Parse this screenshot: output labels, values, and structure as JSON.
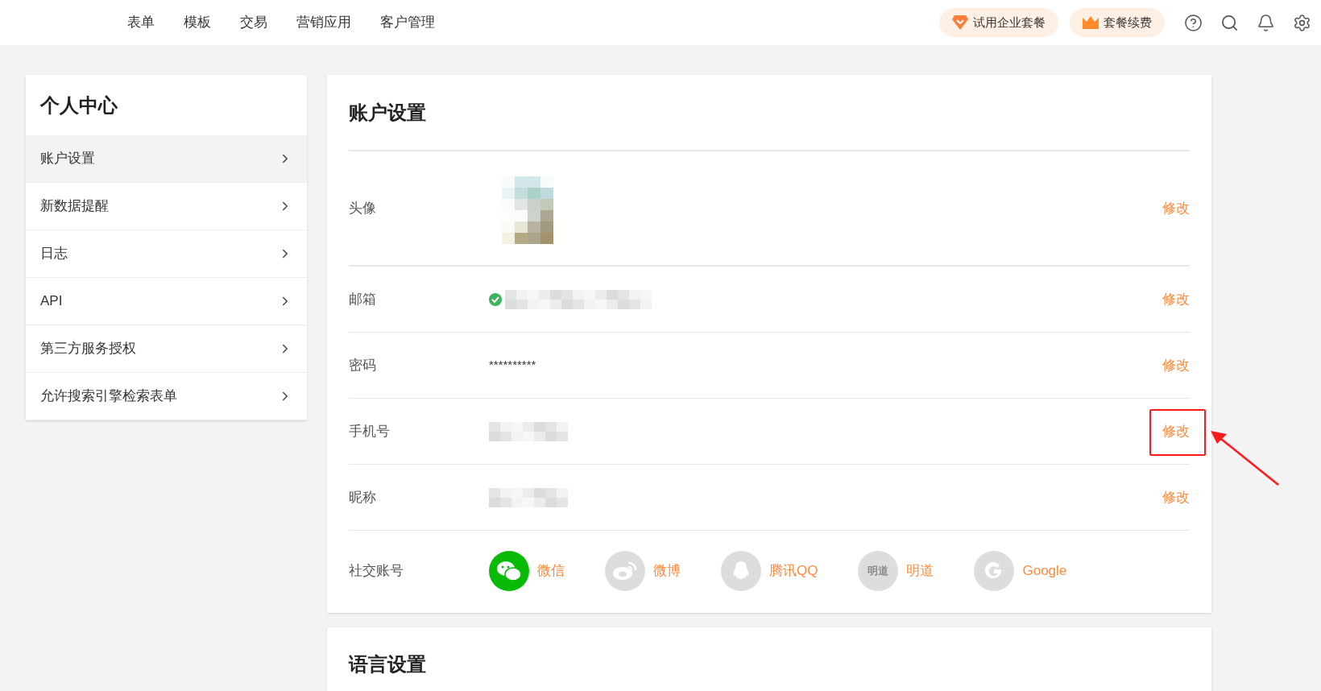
{
  "nav": {
    "items": [
      {
        "label": "表单"
      },
      {
        "label": "模板"
      },
      {
        "label": "交易"
      },
      {
        "label": "营销应用"
      },
      {
        "label": "客户管理"
      }
    ],
    "buttons": [
      {
        "kind": "trial",
        "label": "试用企业套餐"
      },
      {
        "kind": "renew",
        "label": "套餐续费"
      }
    ]
  },
  "sidebar": {
    "title": "个人中心",
    "items": [
      {
        "label": "账户设置",
        "selected": true
      },
      {
        "label": "新数据提醒",
        "selected": false
      },
      {
        "label": "日志",
        "selected": false
      },
      {
        "label": "API",
        "selected": false
      },
      {
        "label": "第三方服务授权",
        "selected": false
      },
      {
        "label": "允许搜索引擎检索表单",
        "selected": false
      }
    ]
  },
  "account": {
    "title": "账户设置",
    "rows": [
      {
        "label": "头像",
        "kind": "avatar",
        "action": "修改",
        "highlighted": false
      },
      {
        "label": "邮箱",
        "kind": "masked",
        "verified": true,
        "action": "修改",
        "highlighted": false
      },
      {
        "label": "密码",
        "kind": "text",
        "value": "**********",
        "action": "修改",
        "highlighted": false
      },
      {
        "label": "手机号",
        "kind": "masked",
        "verified": false,
        "action": "修改",
        "highlighted": true
      },
      {
        "label": "昵称",
        "kind": "masked",
        "verified": false,
        "action": "修改",
        "highlighted": false
      }
    ],
    "social": {
      "label": "社交账号",
      "accounts": [
        {
          "kind": "wechat",
          "label": "微信",
          "linked": true
        },
        {
          "kind": "weibo",
          "label": "微博",
          "linked": false
        },
        {
          "kind": "qq",
          "label": "腾讯QQ",
          "linked": false
        },
        {
          "kind": "mingdao",
          "label": "明道",
          "badge": "明道",
          "linked": false
        },
        {
          "kind": "google",
          "label": "Google",
          "linked": false
        }
      ]
    }
  },
  "language": {
    "title": "语言设置"
  }
}
